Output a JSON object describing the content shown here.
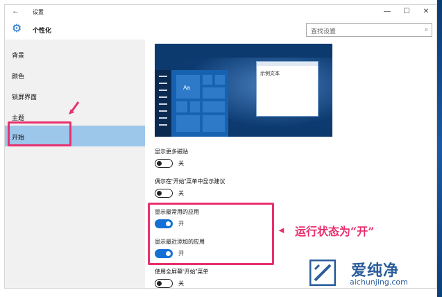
{
  "window": {
    "title": "设置",
    "back_glyph": "←",
    "minimize_glyph": "—",
    "maximize_glyph": "☐",
    "close_glyph": "✕"
  },
  "header": {
    "page_title": "个性化",
    "search_placeholder": "查找设置",
    "gear_glyph": "⚙",
    "search_glyph": "⌕"
  },
  "sidebar": {
    "items": [
      {
        "label": "背景"
      },
      {
        "label": "颜色"
      },
      {
        "label": "锁屏界面"
      },
      {
        "label": "主题"
      },
      {
        "label": "开始",
        "selected": true
      }
    ]
  },
  "preview": {
    "tile_label": "Aa",
    "sample_text": "示例文本"
  },
  "settings": [
    {
      "label": "显示更多磁贴",
      "state": "关",
      "on": false
    },
    {
      "label": "偶尔在“开始”菜单中显示建议",
      "state": "关",
      "on": false
    },
    {
      "label": "显示最常用的应用",
      "state": "开",
      "on": true
    },
    {
      "label": "显示最近添加的应用",
      "state": "开",
      "on": true
    },
    {
      "label": "使用全屏幕“开始”菜单",
      "state": "关",
      "on": false
    }
  ],
  "annotation": {
    "arrow_glyph": "◄",
    "text": "运行状态为“开”"
  },
  "watermark": {
    "name": "爱纯净",
    "url": "aichunjing.com"
  },
  "colors": {
    "accent": "#1470d4",
    "highlight": "#e8306e",
    "selected_nav": "#9cc6ea"
  }
}
